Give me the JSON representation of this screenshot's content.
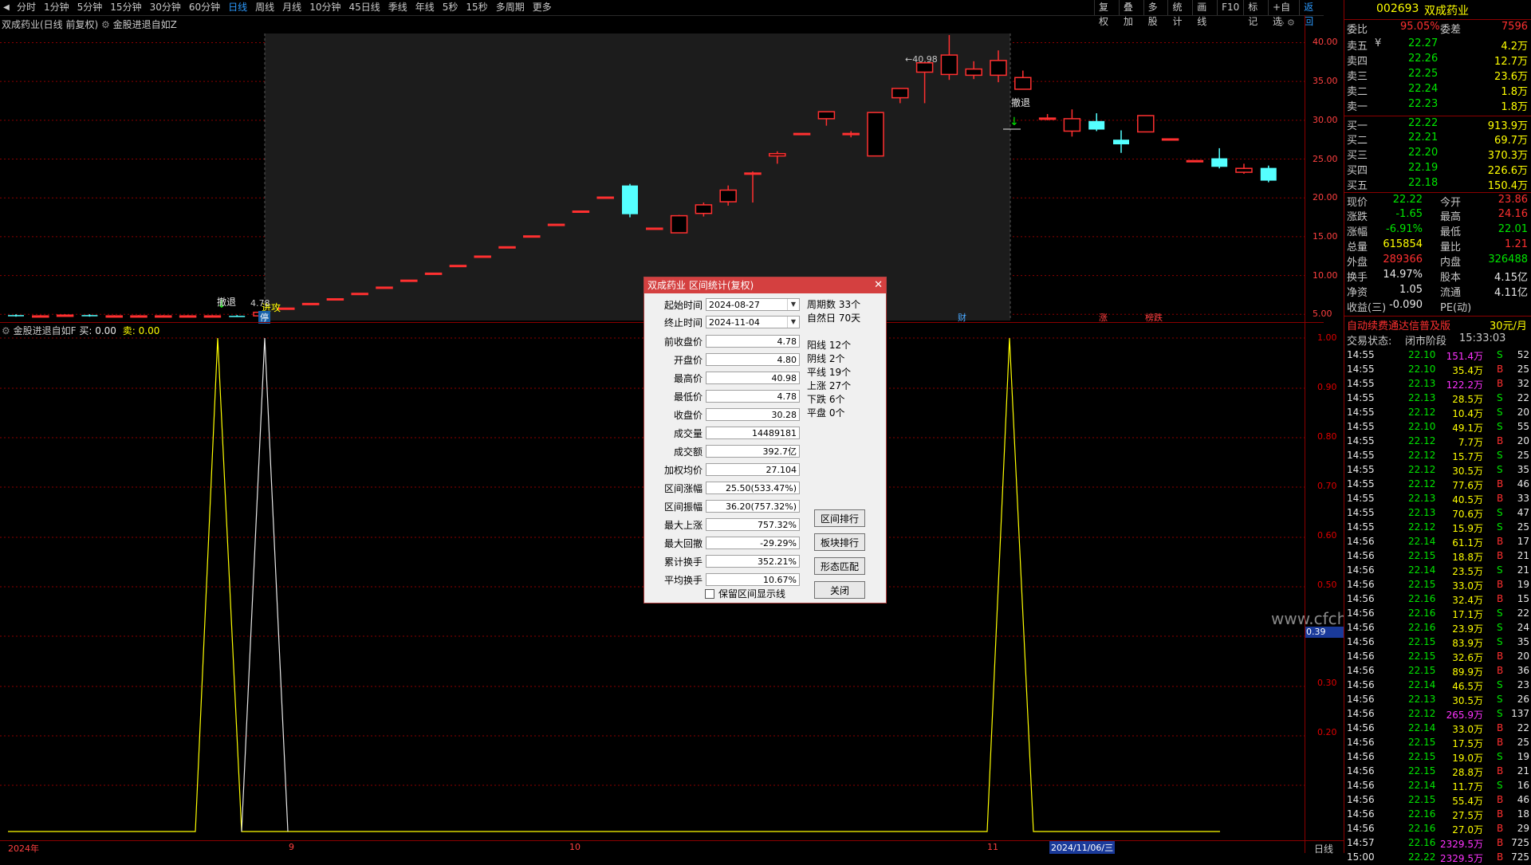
{
  "toolbar": {
    "periods": [
      "分时",
      "1分钟",
      "5分钟",
      "15分钟",
      "30分钟",
      "60分钟",
      "日线",
      "周线",
      "月线",
      "10分钟",
      "45日线",
      "季线",
      "年线",
      "5秒",
      "15秒",
      "多周期",
      "更多"
    ],
    "active_period": "日线",
    "right_tools": [
      "复权",
      "叠加",
      "多股",
      "统计",
      "画线",
      "F10",
      "标记",
      "+自选",
      "返回"
    ]
  },
  "main_chart": {
    "title": "双成药业(日线 前复权)",
    "indicator": "金股进退自如Z",
    "axis": [
      "40.00",
      "35.00",
      "30.00",
      "25.00",
      "20.00",
      "15.00",
      "10.00",
      "5.00"
    ],
    "max_label": "40.98",
    "min_label": "4.78",
    "signals": [
      "撤退",
      "进攻",
      "撤退"
    ],
    "event_tags": [
      "停",
      "财",
      "涨",
      "榜跌"
    ]
  },
  "sub_chart": {
    "title": "金股进退自如F",
    "buy_label": "买:",
    "buy_val": "0.00",
    "sell_label": "卖:",
    "sell_val": "0.00",
    "axis": [
      "1.00",
      "0.90",
      "0.80",
      "0.70",
      "0.60",
      "0.50",
      "0.30",
      "0.20"
    ],
    "cursor_value": "0.39"
  },
  "x_axis": {
    "labels": [
      "2024年",
      "9",
      "10",
      "11"
    ],
    "cursor_date": "2024/11/06/三",
    "period_tag": "日线"
  },
  "watermark": "www.cfchr.com",
  "dialog": {
    "title": "双成药业 区间统计(复权)",
    "start_label": "起始时间",
    "start_date": "2024-08-27",
    "end_label": "终止时间",
    "end_date": "2024-11-04",
    "periods": "周期数 33个",
    "natural_days": "自然日 70天",
    "rows": [
      {
        "label": "前收盘价",
        "value": "4.78"
      },
      {
        "label": "开盘价",
        "value": "4.80"
      },
      {
        "label": "最高价",
        "value": "40.98"
      },
      {
        "label": "最低价",
        "value": "4.78"
      },
      {
        "label": "收盘价",
        "value": "30.28"
      },
      {
        "label": "成交量",
        "value": "14489181"
      },
      {
        "label": "成交额",
        "value": "392.7亿"
      },
      {
        "label": "加权均价",
        "value": "27.104"
      },
      {
        "label": "区间涨幅",
        "value": "25.50(533.47%)"
      },
      {
        "label": "区间振幅",
        "value": "36.20(757.32%)"
      },
      {
        "label": "最大上涨",
        "value": "757.32%"
      },
      {
        "label": "最大回撤",
        "value": "-29.29%"
      },
      {
        "label": "累计换手",
        "value": "352.21%"
      },
      {
        "label": "平均换手",
        "value": "10.67%"
      }
    ],
    "stats": [
      "阳线 12个",
      "阴线 2个",
      "平线 19个",
      "上涨 27个",
      "下跌 6个",
      "平盘 0个"
    ],
    "buttons": [
      "区间排行",
      "板块排行",
      "形态匹配",
      "关闭"
    ],
    "checkbox_label": "保留区间显示线"
  },
  "quote_panel": {
    "code": "002693",
    "name": "双成药业",
    "weibi_label": "委比",
    "weibi": "95.05%",
    "weicha_label": "委差",
    "weicha": "7596",
    "asks": [
      {
        "label": "卖五",
        "price": "22.27",
        "vol": "4.2万",
        "mark": "¥"
      },
      {
        "label": "卖四",
        "price": "22.26",
        "vol": "12.7万",
        "mark": ""
      },
      {
        "label": "卖三",
        "price": "22.25",
        "vol": "23.6万",
        "mark": ""
      },
      {
        "label": "卖二",
        "price": "22.24",
        "vol": "1.8万",
        "mark": ""
      },
      {
        "label": "卖一",
        "price": "22.23",
        "vol": "1.8万",
        "mark": ""
      }
    ],
    "bids": [
      {
        "label": "买一",
        "price": "22.22",
        "vol": "913.9万"
      },
      {
        "label": "买二",
        "price": "22.21",
        "vol": "69.7万"
      },
      {
        "label": "买三",
        "price": "22.20",
        "vol": "370.3万"
      },
      {
        "label": "买四",
        "price": "22.19",
        "vol": "226.6万"
      },
      {
        "label": "买五",
        "price": "22.18",
        "vol": "150.4万"
      }
    ],
    "stats": [
      {
        "l1": "现价",
        "v1": "22.22",
        "l2": "今开",
        "v2": "23.86",
        "c1": "grn",
        "c2": "red"
      },
      {
        "l1": "涨跌",
        "v1": "-1.65",
        "l2": "最高",
        "v2": "24.16",
        "c1": "grn",
        "c2": "red"
      },
      {
        "l1": "涨幅",
        "v1": "-6.91%",
        "l2": "最低",
        "v2": "22.01",
        "c1": "grn",
        "c2": "grn"
      },
      {
        "l1": "总量",
        "v1": "615854",
        "l2": "量比",
        "v2": "1.21",
        "c1": "yel",
        "c2": "red"
      },
      {
        "l1": "外盘",
        "v1": "289366",
        "l2": "内盘",
        "v2": "326488",
        "c1": "red",
        "c2": "grn"
      },
      {
        "l1": "换手",
        "v1": "14.97%",
        "l2": "股本",
        "v2": "4.15亿",
        "c1": "wht",
        "c2": "wht"
      },
      {
        "l1": "净资",
        "v1": "1.05",
        "l2": "流通",
        "v2": "4.11亿",
        "c1": "wht",
        "c2": "wht"
      },
      {
        "l1": "收益(三)",
        "v1": "-0.090",
        "l2": "PE(动)",
        "v2": "",
        "c1": "wht",
        "c2": "wht"
      }
    ],
    "promo": "自动续费通达信普及版",
    "price_tag": "30元/月",
    "trade_status_label": "交易状态:",
    "trade_status": "闭市阶段",
    "trade_time": "15:33:03",
    "ticks": [
      {
        "t": "14:55",
        "p": "22.10",
        "v": "151.4万",
        "s": "S",
        "n": "52",
        "pc": "grn",
        "vc": "mag"
      },
      {
        "t": "14:55",
        "p": "22.10",
        "v": "35.4万",
        "s": "B",
        "n": "25",
        "pc": "grn",
        "vc": "yel"
      },
      {
        "t": "14:55",
        "p": "22.13",
        "v": "122.2万",
        "s": "B",
        "n": "32",
        "pc": "grn",
        "vc": "mag"
      },
      {
        "t": "14:55",
        "p": "22.13",
        "v": "28.5万",
        "s": "S",
        "n": "22",
        "pc": "grn",
        "vc": "yel"
      },
      {
        "t": "14:55",
        "p": "22.12",
        "v": "10.4万",
        "s": "S",
        "n": "20",
        "pc": "grn",
        "vc": "yel"
      },
      {
        "t": "14:55",
        "p": "22.10",
        "v": "49.1万",
        "s": "S",
        "n": "55",
        "pc": "grn",
        "vc": "yel"
      },
      {
        "t": "14:55",
        "p": "22.12",
        "v": "7.7万",
        "s": "B",
        "n": "20",
        "pc": "grn",
        "vc": "yel"
      },
      {
        "t": "14:55",
        "p": "22.12",
        "v": "15.7万",
        "s": "S",
        "n": "25",
        "pc": "grn",
        "vc": "yel"
      },
      {
        "t": "14:55",
        "p": "22.12",
        "v": "30.5万",
        "s": "S",
        "n": "35",
        "pc": "grn",
        "vc": "yel"
      },
      {
        "t": "14:55",
        "p": "22.12",
        "v": "77.6万",
        "s": "B",
        "n": "46",
        "pc": "grn",
        "vc": "yel"
      },
      {
        "t": "14:55",
        "p": "22.13",
        "v": "40.5万",
        "s": "B",
        "n": "33",
        "pc": "grn",
        "vc": "yel"
      },
      {
        "t": "14:55",
        "p": "22.13",
        "v": "70.6万",
        "s": "S",
        "n": "47",
        "pc": "grn",
        "vc": "yel"
      },
      {
        "t": "14:55",
        "p": "22.12",
        "v": "15.9万",
        "s": "S",
        "n": "25",
        "pc": "grn",
        "vc": "yel"
      },
      {
        "t": "14:56",
        "p": "22.14",
        "v": "61.1万",
        "s": "B",
        "n": "17",
        "pc": "grn",
        "vc": "yel"
      },
      {
        "t": "14:56",
        "p": "22.15",
        "v": "18.8万",
        "s": "B",
        "n": "21",
        "pc": "grn",
        "vc": "yel"
      },
      {
        "t": "14:56",
        "p": "22.14",
        "v": "23.5万",
        "s": "S",
        "n": "21",
        "pc": "grn",
        "vc": "yel"
      },
      {
        "t": "14:56",
        "p": "22.15",
        "v": "33.0万",
        "s": "B",
        "n": "19",
        "pc": "grn",
        "vc": "yel"
      },
      {
        "t": "14:56",
        "p": "22.16",
        "v": "32.4万",
        "s": "B",
        "n": "15",
        "pc": "grn",
        "vc": "yel"
      },
      {
        "t": "14:56",
        "p": "22.16",
        "v": "17.1万",
        "s": "S",
        "n": "22",
        "pc": "grn",
        "vc": "yel"
      },
      {
        "t": "14:56",
        "p": "22.16",
        "v": "23.9万",
        "s": "S",
        "n": "24",
        "pc": "grn",
        "vc": "yel"
      },
      {
        "t": "14:56",
        "p": "22.15",
        "v": "83.9万",
        "s": "S",
        "n": "35",
        "pc": "grn",
        "vc": "yel"
      },
      {
        "t": "14:56",
        "p": "22.15",
        "v": "32.6万",
        "s": "B",
        "n": "20",
        "pc": "grn",
        "vc": "yel"
      },
      {
        "t": "14:56",
        "p": "22.15",
        "v": "89.9万",
        "s": "B",
        "n": "36",
        "pc": "grn",
        "vc": "yel"
      },
      {
        "t": "14:56",
        "p": "22.14",
        "v": "46.5万",
        "s": "S",
        "n": "23",
        "pc": "grn",
        "vc": "yel"
      },
      {
        "t": "14:56",
        "p": "22.13",
        "v": "30.5万",
        "s": "S",
        "n": "26",
        "pc": "grn",
        "vc": "yel"
      },
      {
        "t": "14:56",
        "p": "22.12",
        "v": "265.9万",
        "s": "S",
        "n": "137",
        "pc": "grn",
        "vc": "mag"
      },
      {
        "t": "14:56",
        "p": "22.14",
        "v": "33.0万",
        "s": "B",
        "n": "22",
        "pc": "grn",
        "vc": "yel"
      },
      {
        "t": "14:56",
        "p": "22.15",
        "v": "17.5万",
        "s": "B",
        "n": "25",
        "pc": "grn",
        "vc": "yel"
      },
      {
        "t": "14:56",
        "p": "22.15",
        "v": "19.0万",
        "s": "S",
        "n": "19",
        "pc": "grn",
        "vc": "yel"
      },
      {
        "t": "14:56",
        "p": "22.15",
        "v": "28.8万",
        "s": "B",
        "n": "21",
        "pc": "grn",
        "vc": "yel"
      },
      {
        "t": "14:56",
        "p": "22.14",
        "v": "11.7万",
        "s": "S",
        "n": "16",
        "pc": "grn",
        "vc": "yel"
      },
      {
        "t": "14:56",
        "p": "22.15",
        "v": "55.4万",
        "s": "B",
        "n": "46",
        "pc": "grn",
        "vc": "yel"
      },
      {
        "t": "14:56",
        "p": "22.16",
        "v": "27.5万",
        "s": "B",
        "n": "18",
        "pc": "grn",
        "vc": "yel"
      },
      {
        "t": "14:56",
        "p": "22.16",
        "v": "27.0万",
        "s": "B",
        "n": "29",
        "pc": "grn",
        "vc": "yel"
      },
      {
        "t": "14:57",
        "p": "22.16",
        "v": "2329.5万",
        "s": "B",
        "n": "725",
        "pc": "grn",
        "vc": "mag"
      },
      {
        "t": "15:00",
        "p": "22.22",
        "v": "2329.5万",
        "s": "B",
        "n": "725",
        "pc": "grn",
        "vc": "mag"
      }
    ]
  },
  "candles": {
    "price_range": [
      4.0,
      42.0
    ],
    "bars": [
      {
        "o": 4.9,
        "c": 4.8,
        "h": 5.0,
        "l": 4.7
      },
      {
        "o": 4.8,
        "c": 4.8,
        "h": 4.9,
        "l": 4.7
      },
      {
        "o": 4.8,
        "c": 4.9,
        "h": 5.0,
        "l": 4.7
      },
      {
        "o": 4.9,
        "c": 4.8,
        "h": 5.0,
        "l": 4.7
      },
      {
        "o": 4.8,
        "c": 4.8,
        "h": 4.9,
        "l": 4.7
      },
      {
        "o": 4.8,
        "c": 4.8,
        "h": 4.9,
        "l": 4.7
      },
      {
        "o": 4.8,
        "c": 4.8,
        "h": 4.9,
        "l": 4.7
      },
      {
        "o": 4.8,
        "c": 4.8,
        "h": 4.9,
        "l": 4.7
      },
      {
        "o": 4.8,
        "c": 4.8,
        "h": 4.9,
        "l": 4.7
      },
      {
        "o": 4.8,
        "c": 4.78,
        "h": 4.9,
        "l": 4.7
      },
      {
        "o": 4.8,
        "c": 5.26,
        "h": 5.26,
        "l": 4.78
      },
      {
        "o": 5.8,
        "c": 5.8,
        "h": 5.8,
        "l": 5.8
      },
      {
        "o": 6.4,
        "c": 6.4,
        "h": 6.4,
        "l": 6.4
      },
      {
        "o": 7.0,
        "c": 7.0,
        "h": 7.0,
        "l": 7.0
      },
      {
        "o": 7.7,
        "c": 7.7,
        "h": 7.7,
        "l": 7.7
      },
      {
        "o": 8.5,
        "c": 8.5,
        "h": 8.5,
        "l": 8.5
      },
      {
        "o": 9.4,
        "c": 9.4,
        "h": 9.4,
        "l": 9.4
      },
      {
        "o": 10.3,
        "c": 10.3,
        "h": 10.3,
        "l": 10.3
      },
      {
        "o": 11.3,
        "c": 11.3,
        "h": 11.3,
        "l": 11.3
      },
      {
        "o": 12.5,
        "c": 12.5,
        "h": 12.5,
        "l": 12.5
      },
      {
        "o": 13.7,
        "c": 13.7,
        "h": 13.7,
        "l": 13.7
      },
      {
        "o": 15.1,
        "c": 15.1,
        "h": 15.1,
        "l": 15.1
      },
      {
        "o": 16.6,
        "c": 16.6,
        "h": 16.6,
        "l": 16.6
      },
      {
        "o": 18.3,
        "c": 18.3,
        "h": 18.3,
        "l": 18.3
      },
      {
        "o": 20.1,
        "c": 20.1,
        "h": 20.1,
        "l": 20.1
      },
      {
        "o": 21.6,
        "c": 17.9,
        "h": 21.8,
        "l": 17.5
      },
      {
        "o": 16.1,
        "c": 16.1,
        "h": 16.1,
        "l": 16.1
      },
      {
        "o": 15.5,
        "c": 17.7,
        "h": 17.8,
        "l": 15.5
      },
      {
        "o": 18.0,
        "c": 19.1,
        "h": 19.4,
        "l": 17.6
      },
      {
        "o": 19.5,
        "c": 21.0,
        "h": 21.6,
        "l": 19.0
      },
      {
        "o": 23.2,
        "c": 23.2,
        "h": 23.4,
        "l": 19.4
      },
      {
        "o": 25.4,
        "c": 25.7,
        "h": 26.0,
        "l": 24.4
      },
      {
        "o": 28.3,
        "c": 28.3,
        "h": 28.3,
        "l": 28.3
      },
      {
        "o": 30.2,
        "c": 31.1,
        "h": 31.1,
        "l": 29.3
      },
      {
        "o": 28.3,
        "c": 28.3,
        "h": 28.6,
        "l": 27.8
      },
      {
        "o": 25.4,
        "c": 31.0,
        "h": 31.0,
        "l": 25.4
      },
      {
        "o": 32.9,
        "c": 34.1,
        "h": 34.1,
        "l": 32.2
      },
      {
        "o": 36.2,
        "c": 37.4,
        "h": 37.5,
        "l": 32.2
      },
      {
        "o": 35.9,
        "c": 38.4,
        "h": 40.98,
        "l": 35.2
      },
      {
        "o": 35.8,
        "c": 36.6,
        "h": 37.6,
        "l": 35.3
      },
      {
        "o": 35.8,
        "c": 37.7,
        "h": 39.0,
        "l": 34.9
      },
      {
        "o": 34.0,
        "c": 35.5,
        "h": 36.4,
        "l": 34.0
      },
      {
        "o": 30.28,
        "c": 30.28,
        "h": 30.8,
        "l": 30.0
      },
      {
        "o": 28.6,
        "c": 30.2,
        "h": 31.4,
        "l": 27.9
      },
      {
        "o": 29.9,
        "c": 28.8,
        "h": 30.9,
        "l": 28.6
      },
      {
        "o": 27.5,
        "c": 26.9,
        "h": 28.7,
        "l": 25.8
      },
      {
        "o": 28.5,
        "c": 30.6,
        "h": 30.6,
        "l": 28.5
      },
      {
        "o": 27.6,
        "c": 27.6,
        "h": 27.6,
        "l": 27.6
      },
      {
        "o": 24.8,
        "c": 24.8,
        "h": 24.8,
        "l": 24.8
      },
      {
        "o": 25.1,
        "c": 24.0,
        "h": 26.4,
        "l": 23.8
      },
      {
        "o": 23.3,
        "c": 23.8,
        "h": 24.4,
        "l": 23.1
      },
      {
        "o": 23.86,
        "c": 22.22,
        "h": 24.16,
        "l": 22.01
      }
    ]
  }
}
